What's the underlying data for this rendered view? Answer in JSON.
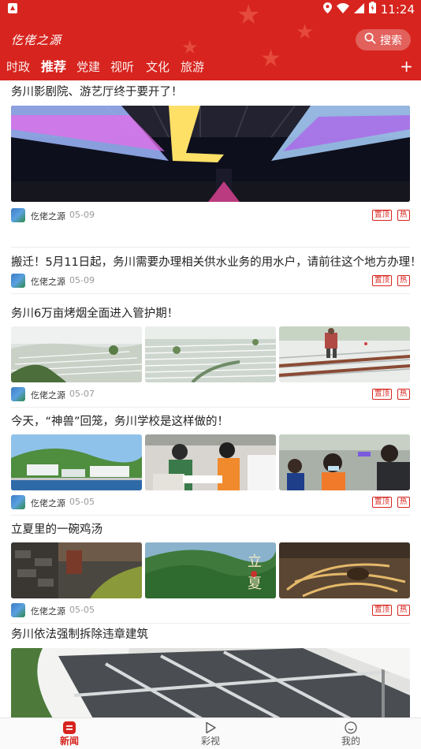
{
  "status_bar": {
    "time": "11:24"
  },
  "header": {
    "logo_text": "仡佬之源",
    "search_label": "搜索",
    "add_tab_label": "+"
  },
  "tabs": [
    {
      "label": "时政"
    },
    {
      "label": "推荐"
    },
    {
      "label": "党建"
    },
    {
      "label": "视听"
    },
    {
      "label": "文化"
    },
    {
      "label": "旅游"
    }
  ],
  "articles": [
    {
      "title": "务川影剧院、游艺厅终于要开了！",
      "source": "仡佬之源",
      "date": "05-09",
      "badge_top": "置顶",
      "badge_hot": "热"
    },
    {
      "title": "搬迁！5月11日起，务川需要办理相关供水业务的用水户，请前往这个地方办理！",
      "source": "仡佬之源",
      "date": "05-09",
      "badge_top": "置顶",
      "badge_hot": "热"
    },
    {
      "title": "务川6万亩烤烟全面进入管护期！",
      "source": "仡佬之源",
      "date": "05-07",
      "badge_top": "置顶",
      "badge_hot": "热"
    },
    {
      "title": "今天，“神兽”回笼，务川学校是这样做的！",
      "source": "仡佬之源",
      "date": "05-05",
      "badge_top": "置顶",
      "badge_hot": "热"
    },
    {
      "title": "立夏里的一碗鸡汤",
      "source": "仡佬之源",
      "date": "05-05",
      "badge_top": "置顶",
      "badge_hot": "热"
    },
    {
      "title": "务川依法强制拆除违章建筑"
    }
  ],
  "bottom_nav": [
    {
      "label": "新闻"
    },
    {
      "label": "彩视"
    },
    {
      "label": "我的"
    }
  ],
  "colors": {
    "brand": "#d7241e"
  }
}
